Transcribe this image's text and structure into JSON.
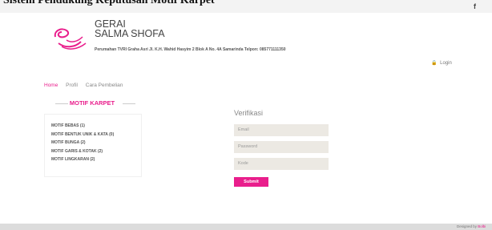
{
  "topbar": {
    "cut_title": "Sistem Pendukung Keputusan Motif Karpet",
    "facebook_icon": "facebook-icon",
    "facebook_glyph": "f"
  },
  "header": {
    "brand_line1": "GERAI",
    "brand_line2": "SALMA SHOFA",
    "address": "Perumahan TVRI Graha Asri Jl. K.H. Wahid Hasyim 2 Blok A No. 4A Samarinda Telpon: 085771111350",
    "login_label": "Login",
    "login_icon": "lock-icon"
  },
  "nav": {
    "items": [
      {
        "label": "Home"
      },
      {
        "label": "Profil"
      },
      {
        "label": "Cara Pembelian"
      }
    ]
  },
  "sidebar": {
    "title": "MOTIF KARPET",
    "items": [
      {
        "label": "MOTIF BEBAS (1)"
      },
      {
        "label": "MOTIF BENTUK UNIK & KATA (0)"
      },
      {
        "label": "MOTIF BUNGA (2)"
      },
      {
        "label": "MOTIF GARIS & KOTAK (2)"
      },
      {
        "label": "MOTIF LINGKARAN (2)"
      }
    ]
  },
  "form": {
    "title": "Verifikasi",
    "email_placeholder": "Email",
    "password_placeholder": "Password",
    "code_placeholder": "Kode",
    "submit_label": "Submit"
  },
  "footer": {
    "credit_prefix": "Designed by",
    "credit_brand": "Bolbi"
  },
  "colors": {
    "accent": "#e91e8c",
    "field_bg": "#ece9e3",
    "footer_bg": "#dcdcdc"
  }
}
